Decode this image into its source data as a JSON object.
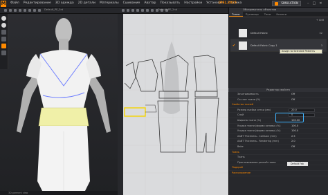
{
  "app": {
    "logo": "M",
    "project": "[PE]_2015",
    "simulation": "SIMULATION",
    "win_controls": [
      "–",
      "□",
      "✕"
    ]
  },
  "menu": [
    "Файл",
    "Редактирование",
    "3D одежда",
    "2D детали",
    "Материалы",
    "Сшивание",
    "Аватар",
    "Показывать",
    "Настройки",
    "Установка",
    "Справка"
  ],
  "views": {
    "title_3d": "Default_PE_3rd",
    "title_2d": "Default_PE_2nd"
  },
  "panel": {
    "title": "Обозреватель объектов",
    "tabs": [
      "Ткань",
      "Пуговица",
      "Тени",
      "Кнопки"
    ],
    "add_label": "+ Add",
    "fabrics": [
      {
        "name": "Default Fabric",
        "count": "32",
        "selected": false
      },
      {
        "name": "Default Fabric Copy 1",
        "count": "3",
        "selected": true
      }
    ],
    "tooltip": "Assign to Selected Patterns"
  },
  "properties": {
    "header": "Редактор свойств",
    "rows": [
      {
        "label": "Зачитываемость",
        "value": "Off",
        "type": "row"
      },
      {
        "label": "Со слот ткани (%)",
        "value": "Off",
        "type": "row"
      },
      {
        "label": "Свойства тканей",
        "value": "",
        "type": "sec"
      },
      {
        "label": "Размер ячейки сетки (мм)",
        "value": "20.0",
        "type": "row"
      },
      {
        "label": "Слой",
        "value": "0",
        "type": "row"
      },
      {
        "label": "Ширина ткани (%)",
        "value": "100.00",
        "type": "row"
      },
      {
        "label": "Усадка ткани (форма основы) (%)",
        "value": "100.0",
        "type": "row"
      },
      {
        "label": "Усадка ткани (форма основы) (%)",
        "value": "100.0",
        "type": "row"
      },
      {
        "label": "AABT Thickness - Collision (mm)",
        "value": "2.5",
        "type": "row"
      },
      {
        "label": "AABT Thickness - Rendering (mm)",
        "value": "2.0",
        "type": "row"
      },
      {
        "label": "Bake",
        "value": "Off",
        "type": "row"
      },
      {
        "label": "Ткань",
        "value": "",
        "type": "sec"
      },
      {
        "label": "Ткань",
        "value": "Default Fab",
        "type": "row"
      },
      {
        "label": "Проглаживание разной ткани",
        "value": "Off",
        "type": "row"
      },
      {
        "label": "Подкрой",
        "value": "",
        "type": "sec"
      },
      {
        "label": "Расположение",
        "value": "",
        "type": "sec"
      }
    ]
  },
  "status": "3D garment view",
  "colors": {
    "accent": "#ff8a00",
    "highlight": "#3fb4ff",
    "peplum": "#f0f0a8"
  }
}
